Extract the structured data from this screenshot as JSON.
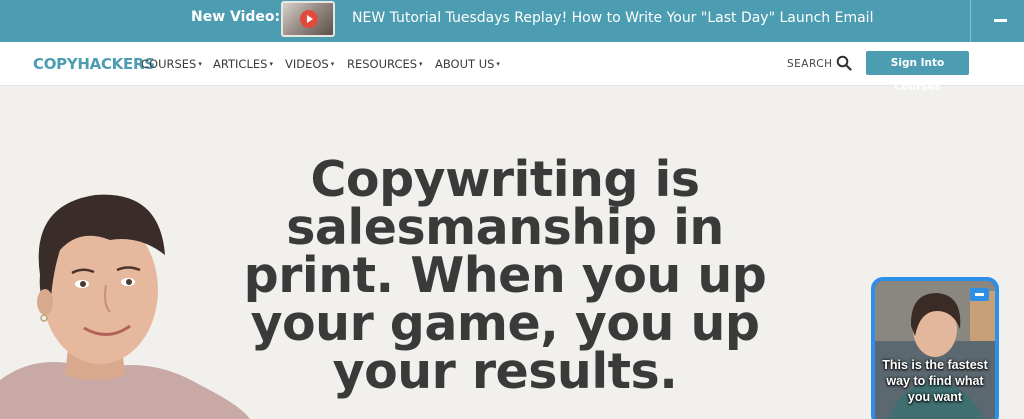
{
  "announcement": {
    "label": "New Video:",
    "text": "NEW Tutorial Tuesdays Replay! How to Write Your \"Last Day\" Launch Email"
  },
  "nav": {
    "logo": "COPYHACKERS",
    "items": [
      {
        "label": "COURSES"
      },
      {
        "label": "ARTICLES"
      },
      {
        "label": "VIDEOS"
      },
      {
        "label": "RESOURCES"
      },
      {
        "label": "ABOUT US"
      }
    ],
    "search_label": "SEARCH",
    "sign_in_label": "Sign Into Courses"
  },
  "hero": {
    "headline_lines": [
      "Copywriting is",
      "salesmanship in",
      "print. When you up",
      "your game, you up",
      "your results."
    ]
  },
  "video_widget": {
    "caption": "This is the fastest way to find what you want"
  },
  "colors": {
    "brand": "#4c9db1",
    "background": "#f1f0ec",
    "headline": "#3a3a3a",
    "widget_border": "#2d8fe8"
  }
}
